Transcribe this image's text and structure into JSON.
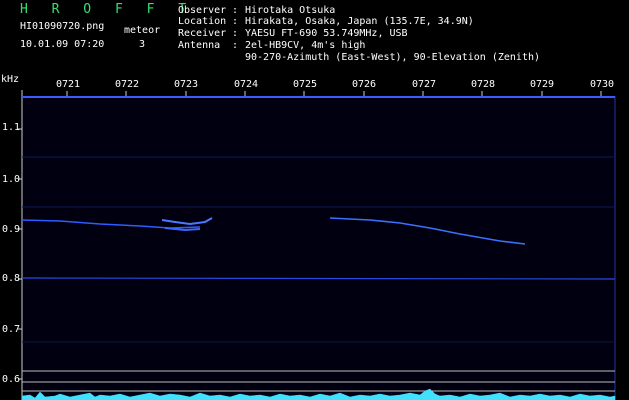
{
  "header": {
    "title": "H R O F F T",
    "filename": "HI01090720.png",
    "datetime": "10.01.09 07:20",
    "counter_label": "meteor",
    "counter_value": "3"
  },
  "station": {
    "observer_label": "Observer",
    "observer": "Hirotaka Otsuka",
    "location_label": "Location",
    "location": "Hirakata, Osaka, Japan (135.7E, 34.9N)",
    "receiver_label": "Receiver",
    "receiver": "YAESU FT-690 53.749MHz, USB",
    "antenna_label": "Antenna",
    "antenna_line1": "2el-HB9CV, 4m's high",
    "antenna_line2": "90-270-Azimuth (East-West), 90-Elevation (Zenith)"
  },
  "plot": {
    "y_unit": "kHz",
    "x_ticks": [
      "0721",
      "0722",
      "0723",
      "0724",
      "0725",
      "0726",
      "0727",
      "0728",
      "0729",
      "0730"
    ],
    "y_ticks": [
      "1.1",
      "1.0",
      "0.9",
      "0.8",
      "0.7",
      "0.6"
    ],
    "colors": {
      "background": "#000010",
      "signal": "#2e5cff",
      "grid": "#cccccc",
      "noise_trace": "#40e0ff"
    }
  }
}
